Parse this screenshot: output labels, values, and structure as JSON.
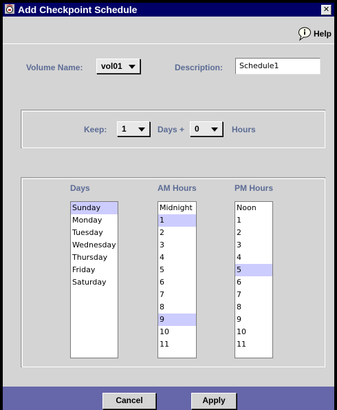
{
  "window": {
    "title": "Add Checkpoint Schedule",
    "close_glyph": "✕"
  },
  "help": {
    "label": "Help",
    "icon": "help-balloon-icon"
  },
  "volume": {
    "label": "Volume Name:",
    "value": "vol01"
  },
  "description": {
    "label": "Description:",
    "value": "Schedule1"
  },
  "keep": {
    "label": "Keep:",
    "days_value": "1",
    "days_label": "Days +",
    "hours_value": "0",
    "hours_label": "Hours"
  },
  "lists": {
    "days": {
      "header": "Days",
      "items": [
        {
          "label": "Sunday",
          "selected": true
        },
        {
          "label": "Monday",
          "selected": false
        },
        {
          "label": "Tuesday",
          "selected": false
        },
        {
          "label": "Wednesday",
          "selected": false
        },
        {
          "label": "Thursday",
          "selected": false
        },
        {
          "label": "Friday",
          "selected": false
        },
        {
          "label": "Saturday",
          "selected": false
        }
      ]
    },
    "am": {
      "header": "AM Hours",
      "items": [
        {
          "label": "Midnight",
          "selected": false
        },
        {
          "label": "1",
          "selected": true
        },
        {
          "label": "2",
          "selected": false
        },
        {
          "label": "3",
          "selected": false
        },
        {
          "label": "4",
          "selected": false
        },
        {
          "label": "5",
          "selected": false
        },
        {
          "label": "6",
          "selected": false
        },
        {
          "label": "7",
          "selected": false
        },
        {
          "label": "8",
          "selected": false
        },
        {
          "label": "9",
          "selected": true
        },
        {
          "label": "10",
          "selected": false
        },
        {
          "label": "11",
          "selected": false
        }
      ]
    },
    "pm": {
      "header": "PM Hours",
      "items": [
        {
          "label": "Noon",
          "selected": false
        },
        {
          "label": "1",
          "selected": false
        },
        {
          "label": "2",
          "selected": false
        },
        {
          "label": "3",
          "selected": false
        },
        {
          "label": "4",
          "selected": false
        },
        {
          "label": "5",
          "selected": true
        },
        {
          "label": "6",
          "selected": false
        },
        {
          "label": "7",
          "selected": false
        },
        {
          "label": "8",
          "selected": false
        },
        {
          "label": "9",
          "selected": false
        },
        {
          "label": "10",
          "selected": false
        },
        {
          "label": "11",
          "selected": false
        }
      ]
    }
  },
  "buttons": {
    "cancel": "Cancel",
    "apply": "Apply"
  },
  "colors": {
    "titlebar": "#000066",
    "label": "#5b6b94",
    "selection": "#ccccff",
    "footer": "#6666aa"
  }
}
